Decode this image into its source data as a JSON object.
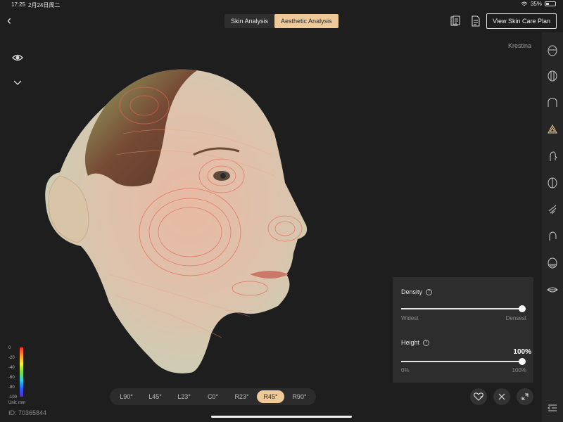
{
  "status": {
    "time": "17:25",
    "date": "2月24日周二",
    "battery": "35%"
  },
  "tabs": [
    "Skin Analysis",
    "Aesthetic Analysis"
  ],
  "active_tab": 1,
  "header": {
    "plan_button": "View Skin Care Plan"
  },
  "user": {
    "name": "Krestina"
  },
  "session": {
    "id": "ID:  70365844"
  },
  "legend": {
    "ticks": [
      "0",
      "-20",
      "-40",
      "-60",
      "-80",
      "-100"
    ],
    "unit": "Unit: mm"
  },
  "angles": [
    "L90°",
    "L45°",
    "L23°",
    "C0°",
    "R23°",
    "R45°",
    "R90°"
  ],
  "active_angle": 5,
  "panel": {
    "density": {
      "label": "Density",
      "min": "Widest",
      "max": "Densest",
      "value": 1.0
    },
    "height": {
      "label": "Height",
      "min": "0%",
      "max": "100%",
      "value_text": "100%",
      "value": 1.0
    }
  },
  "colors": {
    "accent": "#efc998"
  },
  "sidebar_icons": [
    "face-outline-icon",
    "forehead-grid-icon",
    "brow-icon",
    "contour-map-icon",
    "profile-icon",
    "face-half-icon",
    "jawline-icon",
    "ear-icon",
    "chin-icon",
    "lips-icon"
  ],
  "sidebar_active": 3
}
